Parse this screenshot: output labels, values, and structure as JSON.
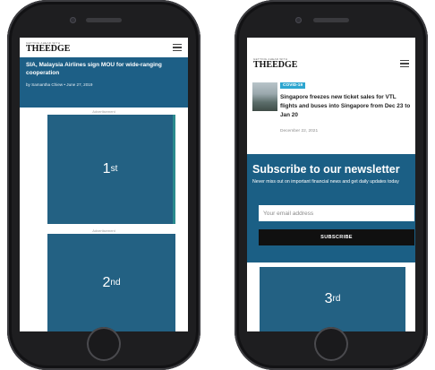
{
  "logo": {
    "tagline": "GETTING AHEAD WITH",
    "name": "THEEDGE"
  },
  "left_screen": {
    "article_title": "SIA, Malaysia Airlines sign MOU for wide-ranging cooperation",
    "byline": "by Samantha Chiew • June 27, 2019",
    "ads": [
      {
        "label": "Advertisement",
        "number": "1",
        "suffix": "st"
      },
      {
        "label": "Advertisement",
        "number": "2",
        "suffix": "nd"
      }
    ]
  },
  "right_screen": {
    "news": {
      "badge": "COVID-19",
      "headline": "Singapore freezes new ticket sales for VTL flights and buses into Singapore from Dec 23 to Jan 20",
      "date": "December 22, 2021"
    },
    "newsletter": {
      "title": "Subscribe to our newsletter",
      "text": "Never miss out on important financial news and get daily updates today",
      "email_placeholder": "Your email address",
      "email_value": "",
      "button_label": "SUBSCRIBE"
    },
    "ad": {
      "number": "3",
      "suffix": "rd"
    }
  }
}
